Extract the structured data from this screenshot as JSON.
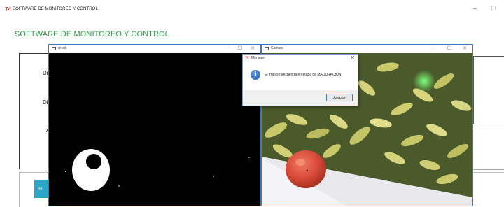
{
  "main_window": {
    "logo": "74",
    "title": "SOFTWARE DE MONITOREO Y CONTROL",
    "minimize_glyph": "–",
    "maximize_glyph": "☐"
  },
  "app": {
    "heading": "SOFTWARE DE MONITOREO Y CONTROL",
    "partial_labels": [
      "Di",
      "Di",
      "A"
    ],
    "start_button_label": "INI"
  },
  "threshold_window": {
    "title": "result",
    "controls": [
      "–",
      "☐",
      "✕"
    ]
  },
  "camera_window": {
    "title": "Camara",
    "controls": [
      "–",
      "☐",
      "✕"
    ]
  },
  "dialog": {
    "logo": "74",
    "title": "Mensaje",
    "close_glyph": "✕",
    "icon": "info-icon",
    "message": "El fruto se encuentra en etapa de MADURACIÓN",
    "ok_label": "Aceptar"
  },
  "colors": {
    "heading_green": "#2e9e4a",
    "window_border_blue": "#3c7abf",
    "start_button": "#2aa7c7",
    "fruit_red": "#d94a3a"
  }
}
